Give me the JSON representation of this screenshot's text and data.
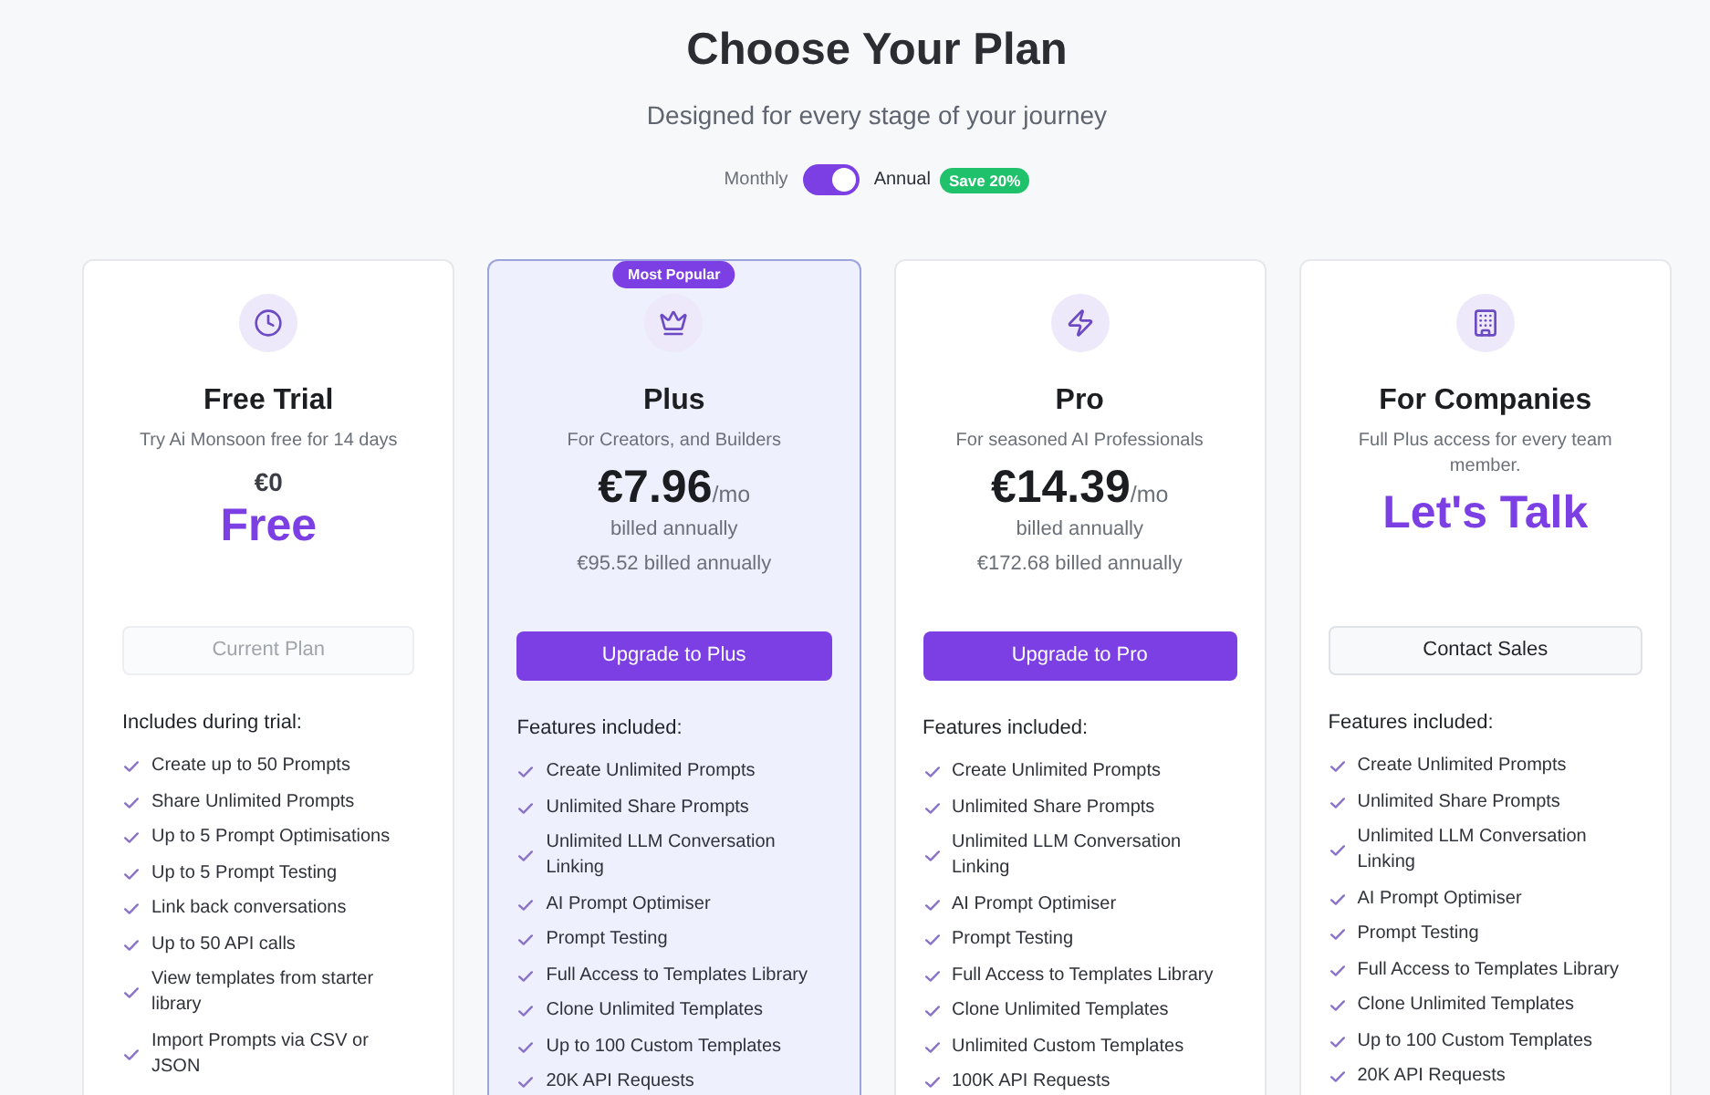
{
  "header": {
    "title": "Choose Your Plan",
    "subtitle": "Designed for every stage of your journey"
  },
  "billing": {
    "monthly_label": "Monthly",
    "annual_label": "Annual",
    "annual": true,
    "discount_badge": "Save 20%"
  },
  "plans": [
    {
      "kind": "trial",
      "highlighted": false,
      "name": "Free Trial",
      "description": "Try Ai Monsoon free for 14 days",
      "price": "€0",
      "price_label": "Free",
      "button": {
        "label": "Current Plan",
        "kind": "secondary",
        "disabled": true
      },
      "features_heading": "Includes during trial:",
      "features": [
        "Create up to 50 Prompts",
        "Share Unlimited Prompts",
        "Up to 5 Prompt Optimisations",
        "Up to 5 Prompt Testing",
        "Link back conversations",
        "Up to 50 API calls",
        "View templates from starter library",
        "Import Prompts via CSV or JSON"
      ]
    },
    {
      "kind": "paid",
      "highlighted": true,
      "badge": "Most Popular",
      "name": "Plus",
      "description": "For Creators, and Builders",
      "price": "€7.96",
      "period": "/mo",
      "billing_note": "billed annually",
      "annual_total": "€95.52 billed annually",
      "button": {
        "label": "Upgrade to Plus",
        "kind": "primary",
        "disabled": false
      },
      "features_heading": "Features included:",
      "features": [
        "Create Unlimited Prompts",
        "Unlimited Share Prompts",
        "Unlimited LLM Conversation Linking",
        "AI Prompt Optimiser",
        "Prompt Testing",
        "Full Access to Templates Library",
        "Clone Unlimited Templates",
        "Up to 100 Custom Templates",
        "20K API Requests"
      ]
    },
    {
      "kind": "paid",
      "highlighted": false,
      "name": "Pro",
      "description": "For seasoned AI Professionals",
      "price": "€14.39",
      "period": "/mo",
      "billing_note": "billed annually",
      "annual_total": "€172.68 billed annually",
      "button": {
        "label": "Upgrade to Pro",
        "kind": "primary",
        "disabled": false
      },
      "features_heading": "Features included:",
      "features": [
        "Create Unlimited Prompts",
        "Unlimited Share Prompts",
        "Unlimited LLM Conversation Linking",
        "AI Prompt Optimiser",
        "Prompt Testing",
        "Full Access to Templates Library",
        "Clone Unlimited Templates",
        "Unlimited Custom Templates",
        "100K API Requests"
      ]
    },
    {
      "kind": "contact",
      "highlighted": false,
      "name": "For Companies",
      "description": "Full Plus access for every team member.",
      "price_label": "Let's Talk",
      "button": {
        "label": "Contact Sales",
        "kind": "secondary",
        "disabled": false
      },
      "features_heading": "Features included:",
      "features": [
        "Create Unlimited Prompts",
        "Unlimited Share Prompts",
        "Unlimited LLM Conversation Linking",
        "AI Prompt Optimiser",
        "Prompt Testing",
        "Full Access to Templates Library",
        "Clone Unlimited Templates",
        "Up to 100 Custom Templates",
        "20K API Requests"
      ]
    }
  ]
}
